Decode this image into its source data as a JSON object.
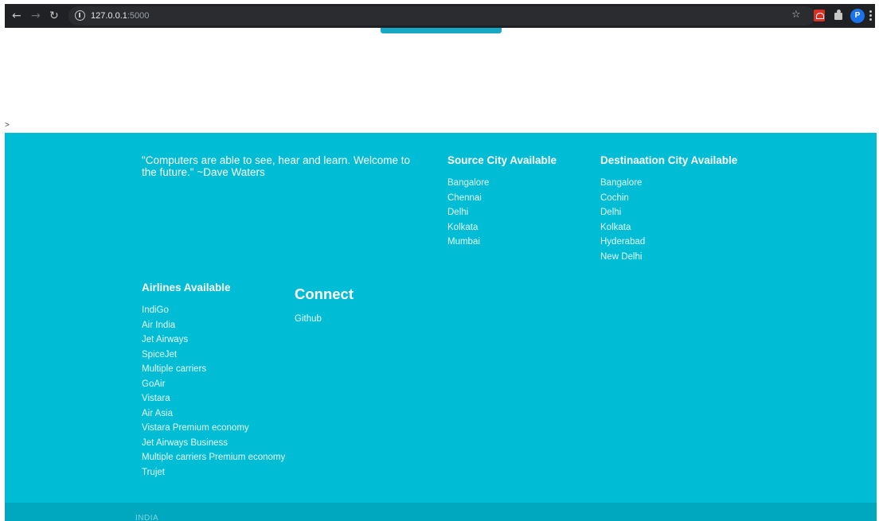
{
  "browser": {
    "url_host": "127.0.0.1",
    "url_rest": ":5000",
    "profile_initial": "P"
  },
  "page": {
    "caret": ">"
  },
  "footer": {
    "quote": "\"Computers are able to see, hear and learn. Welcome to the future.\" ~Dave Waters",
    "source": {
      "title": "Source City Available",
      "items": [
        "Bangalore",
        "Chennai",
        "Delhi",
        "Kolkata",
        "Mumbai"
      ]
    },
    "destination": {
      "title": "Destinaation City Available",
      "items": [
        "Bangalore",
        "Cochin",
        "Delhi",
        "Kolkata",
        "Hyderabad",
        "New Delhi"
      ]
    },
    "airlines": {
      "title": "Airlines Available",
      "items": [
        "IndiGo",
        "Air India",
        "Jet Airways",
        "SpiceJet",
        "Multiple carriers",
        "GoAir",
        "Vistara",
        "Air Asia",
        "Vistara Premium economy",
        "Jet Airways Business",
        "Multiple carriers Premium economy",
        "Trujet"
      ]
    },
    "connect": {
      "title": "Connect",
      "link": "Github"
    }
  },
  "bottom_bar": {
    "text": "INDIA"
  },
  "colors": {
    "footer_bg": "#00bcd4",
    "bottom_bar_bg": "#00a8bf",
    "chrome_bg": "#202124"
  }
}
